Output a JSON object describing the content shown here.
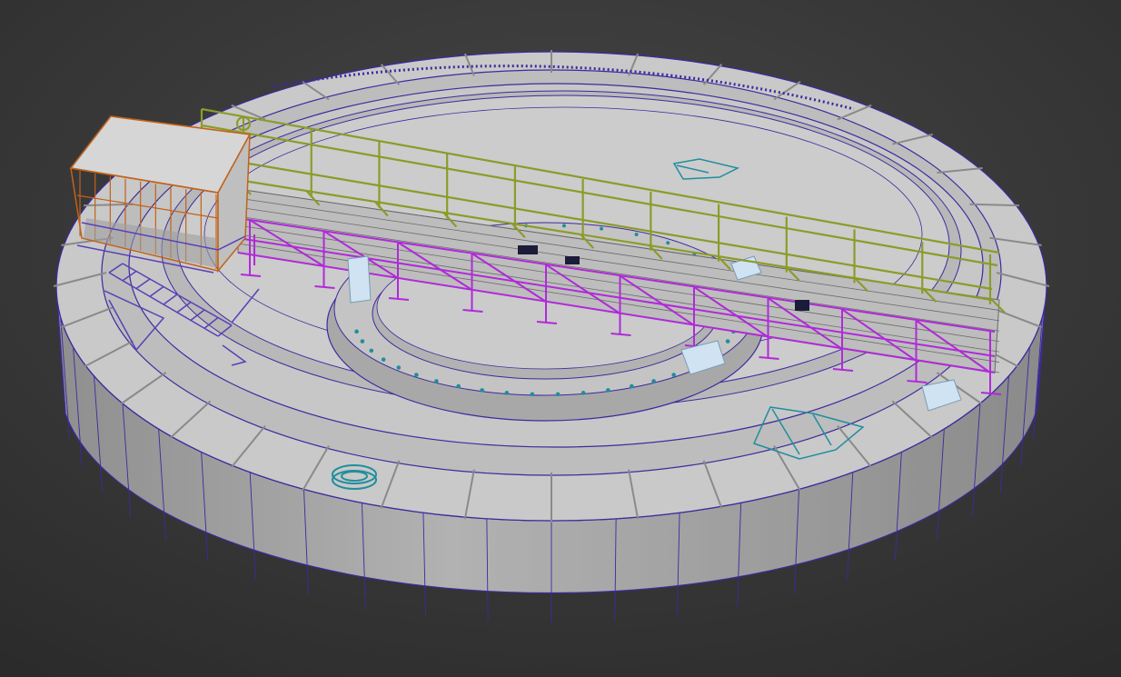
{
  "viewport": {
    "background_top": "#474747",
    "background_bottom": "#2b2b2b"
  },
  "colors": {
    "concrete_top": "#c8c8c8",
    "concrete_side": "#a3a3a3",
    "edge": "#3d2a9e",
    "railing": "#8c9b2a",
    "bridge_frame": "#b02ad8",
    "operator_house": "#c2621a",
    "equipment": "#1f8e9e",
    "drive_unit": "#cfe3f2",
    "stairs": "#5b3fb8"
  },
  "objects": [
    {
      "name": "clarifier-tank-wall",
      "icon": "tank-icon"
    },
    {
      "name": "bridge-walkway",
      "icon": "bridge-icon"
    },
    {
      "name": "bridge-handrail",
      "icon": "railing-icon"
    },
    {
      "name": "operator-house",
      "icon": "house-icon"
    },
    {
      "name": "access-stairs",
      "icon": "stairs-icon"
    },
    {
      "name": "center-well",
      "icon": "well-icon"
    },
    {
      "name": "scraper-blades",
      "icon": "blade-icon"
    },
    {
      "name": "life-ring",
      "icon": "ring-icon"
    }
  ]
}
